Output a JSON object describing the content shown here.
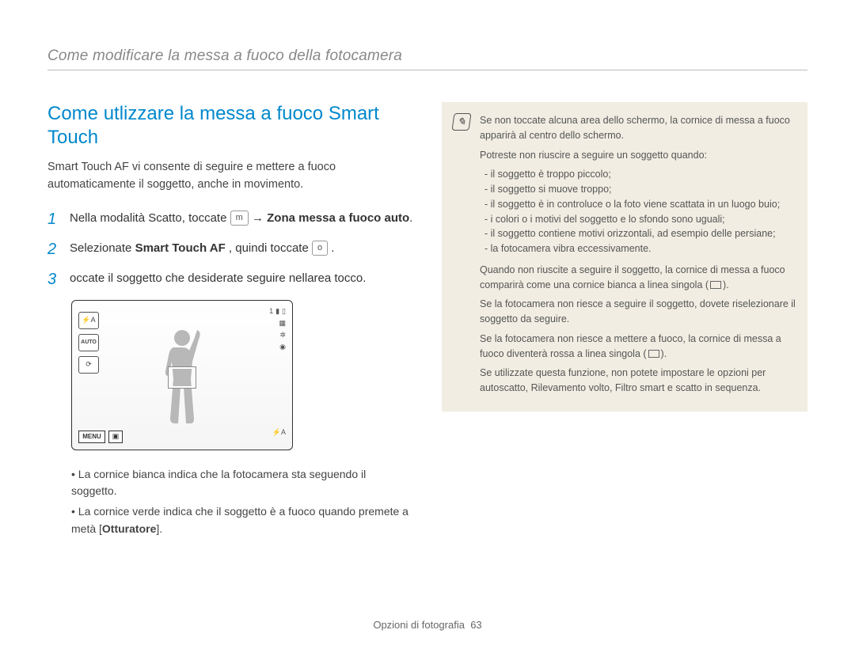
{
  "header": {
    "title": "Come modificare la messa a fuoco della fotocamera"
  },
  "section": {
    "title": "Come utlizzare la messa a fuoco Smart Touch",
    "intro": "Smart Touch AF vi consente di seguire e mettere a fuoco automaticamente il soggetto, anche in movimento."
  },
  "steps": [
    {
      "num": "1",
      "pre": "Nella modalità Scatto, toccate ",
      "icon": "m",
      "arrow": " → ",
      "bold": "Zona messa a fuoco auto",
      "post": "."
    },
    {
      "num": "2",
      "pre": "Selezionate ",
      "bold": "Smart Touch AF",
      "mid": ", quindi toccate ",
      "icon": "o",
      "post": " ."
    },
    {
      "num": "3",
      "pre": "",
      "plain": "occate il soggetto che desiderate seguire nellarea tocco."
    }
  ],
  "camera": {
    "menu": "MENU",
    "topnum": "1",
    "flash_icon": "⚡A"
  },
  "bullets": [
    "La cornice bianca indica che la fotocamera sta seguendo il soggetto.",
    "La cornice verde indica che il soggetto è a fuoco quando premete a metà [Otturatore]."
  ],
  "bulletsBoldWords": {
    "otturatore": "Otturatore"
  },
  "notebox": {
    "p1": "Se non toccate alcuna area dello schermo, la cornice di messa a fuoco apparirà al centro dello schermo.",
    "p2": "Potreste non riuscire a seguire un soggetto quando:",
    "reasons": [
      "il soggetto è troppo piccolo;",
      "il soggetto si muove troppo;",
      "il soggetto è in controluce o la foto viene scattata in un luogo buio;",
      "i colori o i motivi del soggetto e lo sfondo sono uguali;",
      "il soggetto contiene motivi orizzontali, ad esempio delle persiane;",
      "la fotocamera vibra eccessivamente."
    ],
    "p3": "Quando non riuscite a seguire il soggetto, la cornice di messa a fuoco comparirà come una cornice bianca a linea singola (      ).",
    "p4": "Se la fotocamera non riesce a seguire il soggetto, dovete riselezionare il soggetto da seguire.",
    "p5": "Se la fotocamera non riesce a mettere a fuoco, la cornice di messa a fuoco diventerà rossa a linea singola (      ).",
    "p6": "Se utilizzate questa funzione, non potete impostare le opzioni per autoscatto, Rilevamento volto, Filtro smart e scatto in sequenza."
  },
  "footer": {
    "section": "Opzioni di fotografia",
    "page": "63"
  }
}
